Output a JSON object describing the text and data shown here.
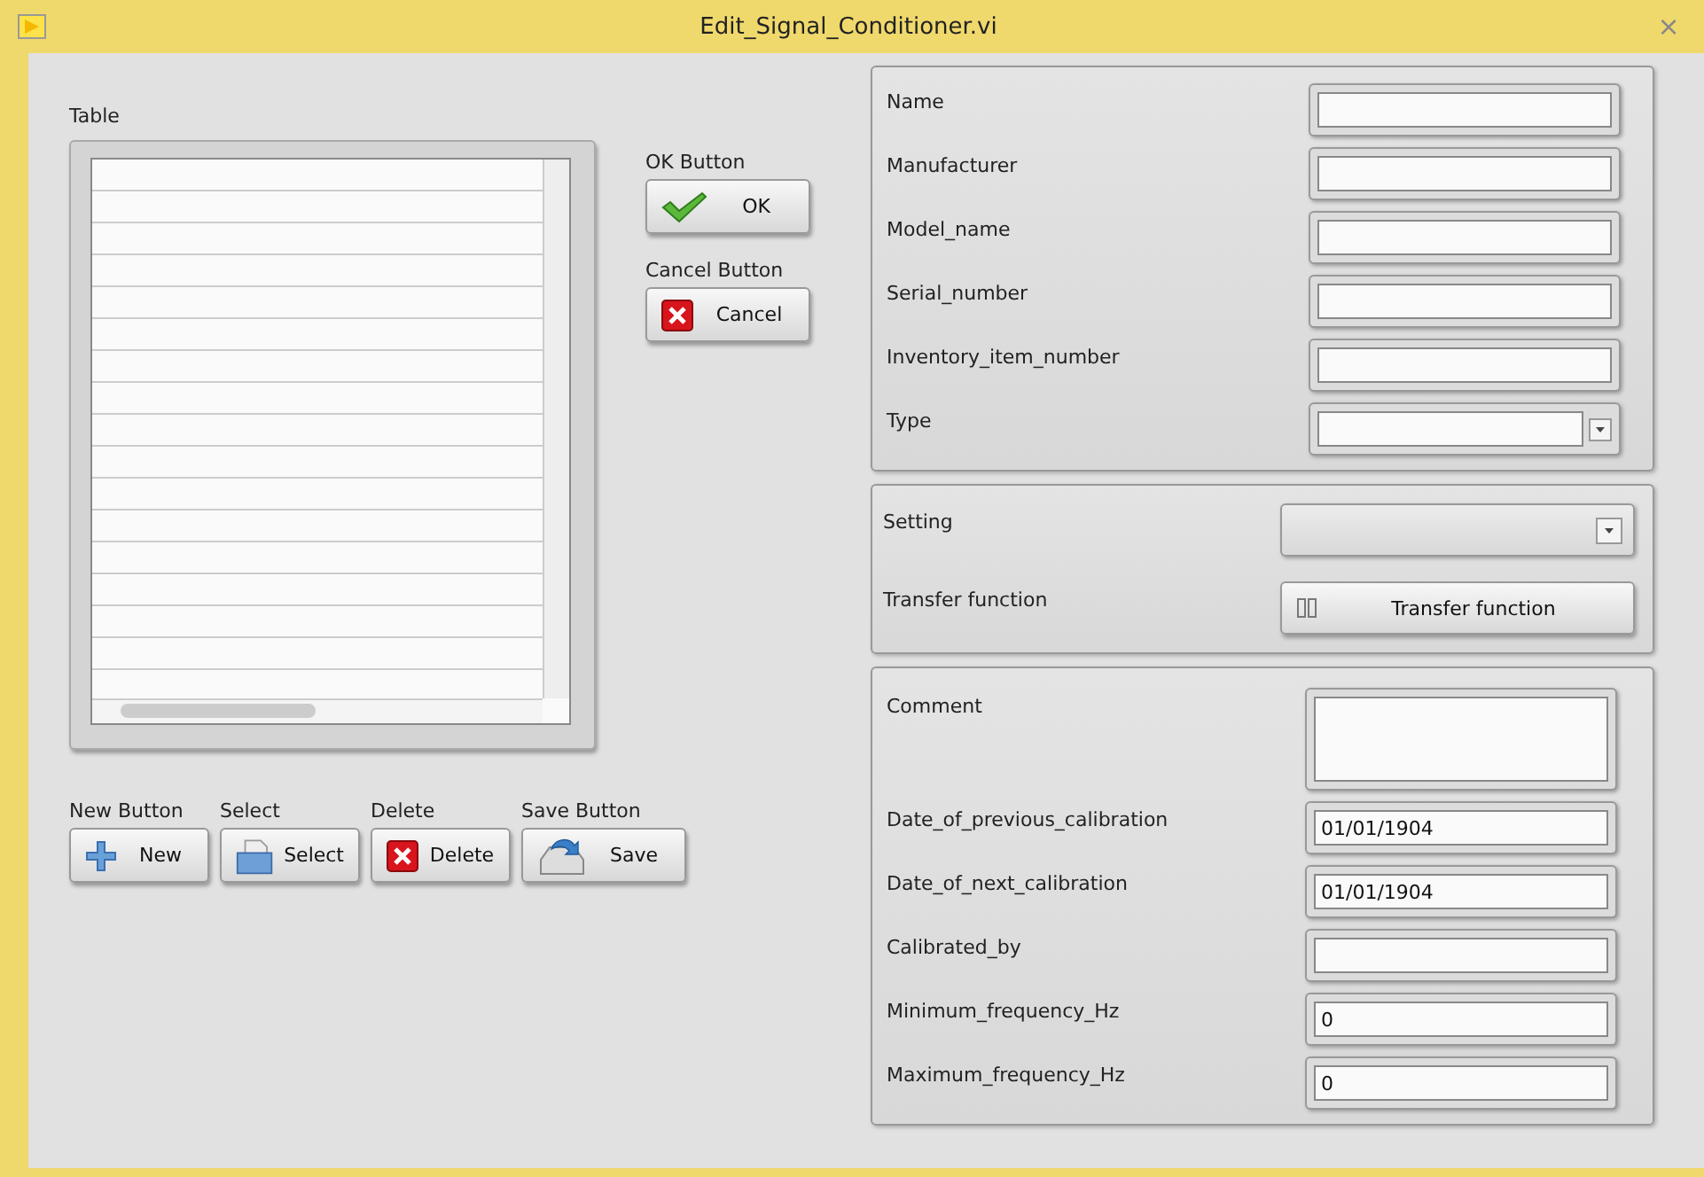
{
  "window": {
    "title": "Edit_Signal_Conditioner.vi",
    "close": "×"
  },
  "table": {
    "label": "Table"
  },
  "side_buttons": [
    {
      "label": "OK Button",
      "text": "OK",
      "kind": "check"
    },
    {
      "label": "Cancel Button",
      "text": "Cancel",
      "kind": "cross"
    }
  ],
  "bottom_buttons": [
    {
      "label": "New Button",
      "text": "New",
      "kind": "plus"
    },
    {
      "label": "Select",
      "text": "Select",
      "kind": "folder"
    },
    {
      "label": "Delete",
      "text": "Delete",
      "kind": "cross"
    },
    {
      "label": "Save Button",
      "text": "Save",
      "kind": "save"
    }
  ],
  "panels": [
    {
      "fields": [
        {
          "kind": "text",
          "label": "Name"
        },
        {
          "kind": "text",
          "label": "Manufacturer"
        },
        {
          "kind": "text",
          "label": "Model_name"
        },
        {
          "kind": "text",
          "label": "Serial_number"
        },
        {
          "kind": "text",
          "label": "Inventory_item_number"
        },
        {
          "kind": "combo",
          "label": "Type"
        }
      ]
    },
    {
      "fields": [
        {
          "kind": "ring",
          "label": "Setting"
        },
        {
          "kind": "button",
          "label": "Transfer function",
          "text": "Transfer function"
        }
      ]
    },
    {
      "fields": [
        {
          "kind": "textarea",
          "label": "Comment"
        },
        {
          "kind": "text",
          "label": "Date_of_previous_calibration",
          "value": "01/01/1904"
        },
        {
          "kind": "text",
          "label": "Date_of_next_calibration",
          "value": "01/01/1904"
        },
        {
          "kind": "text",
          "label": "Calibrated_by"
        },
        {
          "kind": "text",
          "label": "Minimum_frequency_Hz",
          "value": "0"
        },
        {
          "kind": "text",
          "label": "Maximum_frequency_Hz",
          "value": "0"
        }
      ]
    }
  ]
}
